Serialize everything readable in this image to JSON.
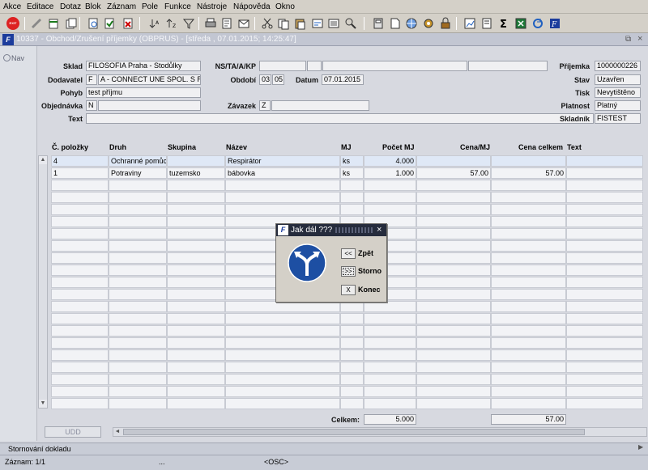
{
  "menu": [
    "Akce",
    "Editace",
    "Dotaz",
    "Blok",
    "Záznam",
    "Pole",
    "Funkce",
    "Nástroje",
    "Nápověda",
    "Okno"
  ],
  "toolbar": {
    "exit_label": "EXIT"
  },
  "window": {
    "title": "10337 - Obchod/Zrušení příjemky (OBPRUS) - [středa , 07.01.2015; 14:25:47]",
    "logo": "F"
  },
  "nav": {
    "label": "Nav"
  },
  "header": {
    "sklad_label": "Sklad",
    "sklad_value": "FILOSOFIA Praha - Stodůlky",
    "dodavatel_label": "Dodavatel",
    "dodavatel_code": "F",
    "dodavatel_value": "A - CONNECT UNE SPOL. S R. O",
    "pohyb_label": "Pohyb",
    "pohyb_value": "test příjmu",
    "objednavka_label": "Objednávka",
    "objednavka_code": "N",
    "text_label": "Text",
    "ns_label": "NS/TA/A/KP",
    "obdobi_label": "Období",
    "obdobi_month": "03",
    "obdobi_day": "05",
    "datum_label": "Datum",
    "datum_value": "07.01.2015",
    "zavazek_label": "Závazek",
    "zavazek_code": "Z",
    "prijemka_label": "Příjemka",
    "prijemka_value": "1000000226",
    "stav_label": "Stav",
    "stav_value": "Uzavřen",
    "tisk_label": "Tisk",
    "tisk_value": "Nevytištěno",
    "platnost_label": "Platnost",
    "platnost_value": "Platný",
    "skladnik_label": "Skladník",
    "skladnik_value": "FISTEST"
  },
  "grid": {
    "columns": [
      "Č. položky",
      "Druh",
      "Skupina",
      "Název",
      "MJ",
      "Počet MJ",
      "Cena/MJ",
      "Cena celkem",
      "Text"
    ],
    "rows": [
      {
        "c": "4",
        "druh": "Ochranné pomůcl",
        "skupina": "",
        "nazev": "Respirátor",
        "mj": "ks",
        "pocet": "4.000",
        "cena": "",
        "celkem": "",
        "text": ""
      },
      {
        "c": "1",
        "druh": "Potraviny",
        "skupina": "tuzemsko",
        "nazev": "bábovka",
        "mj": "ks",
        "pocet": "1.000",
        "cena": "57.00",
        "celkem": "57.00",
        "text": ""
      }
    ],
    "total_label": "Celkem:",
    "total_pocet": "5.000",
    "total_celkem": "57.00",
    "udd_label": "UDD"
  },
  "status": {
    "message": "Stornování dokladu",
    "record": "Záznam: 1/1",
    "dots": "...",
    "mode": "<OSC>"
  },
  "dialog": {
    "title": "Jak dál ???",
    "zpet_btn": "<<",
    "zpet_label": "Zpět",
    "storno_btn": ">>",
    "storno_label": "Storno",
    "konec_btn": "X",
    "konec_label": "Konec"
  }
}
